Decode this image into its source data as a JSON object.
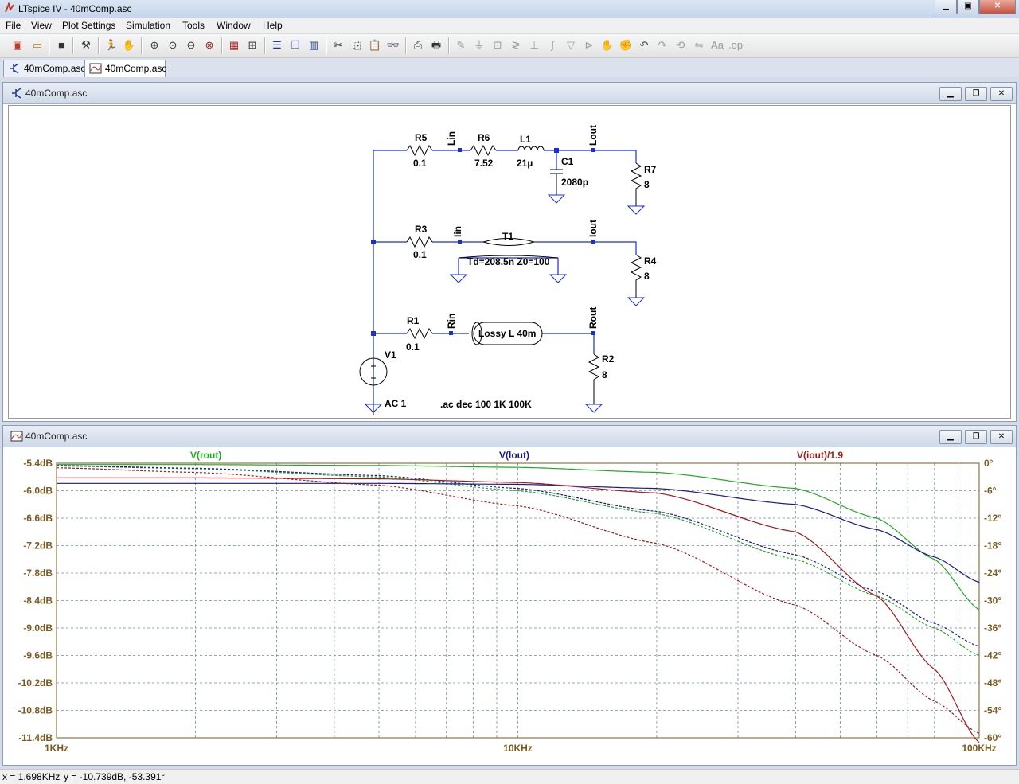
{
  "window": {
    "title": "LTspice IV - 40mComp.asc"
  },
  "menu": [
    "File",
    "View",
    "Plot Settings",
    "Simulation",
    "Tools",
    "Window",
    "Help"
  ],
  "toolbar_icons": [
    "new-schematic",
    "open",
    "save",
    "control-panel",
    "run",
    "halt",
    "zoom-in",
    "zoom-pan",
    "zoom-out",
    "zoom-cancel",
    "autorange",
    "zoom-fit",
    "tile-horizontal",
    "cascade",
    "tile-vertical",
    "cut",
    "copy",
    "paste",
    "find",
    "print-setup",
    "print",
    "wire",
    "ground",
    "label-net",
    "resistor",
    "capacitor",
    "inductor",
    "diode",
    "component",
    "move",
    "drag",
    "undo",
    "redo",
    "rotate",
    "mirror",
    "text",
    "spice-directive"
  ],
  "tabs": [
    {
      "label": "40mComp.asc",
      "icon": "schematic-icon"
    },
    {
      "label": "40mComp.asc",
      "icon": "waveform-icon"
    }
  ],
  "schematic": {
    "title": "40mComp.asc",
    "labels": {
      "R5": "R5",
      "R5v": "0.1",
      "R6": "R6",
      "R6v": "7.52",
      "L1": "L1",
      "L1v": "21µ",
      "C1": "C1",
      "C1v": "2080p",
      "R7": "R7",
      "R7v": "8",
      "R3": "R3",
      "R3v": "0.1",
      "T1": "T1",
      "T1v": "Td=208.5n Z0=100",
      "R4": "R4",
      "R4v": "8",
      "R1": "R1",
      "R1v": "0.1",
      "lossy": "Lossy L 40m",
      "R2": "R2",
      "R2v": "8",
      "V1": "V1",
      "V1v": "AC 1",
      "directive": ".ac dec 100 1K 100K",
      "Lin": "Lin",
      "Lout": "Lout",
      "Iin": "Iin",
      "Iout": "Iout",
      "Rin": "Rin",
      "Rout": "Rout"
    }
  },
  "plot": {
    "title": "40mComp.asc",
    "trace_labels": {
      "rout": "V(rout)",
      "lout": "V(lout)",
      "iout": "V(iout)/1.9"
    },
    "colors": {
      "rout": "#22a822",
      "lout": "#1a1a8c",
      "iout": "#9e1a1a",
      "grid": "#6f86b0",
      "axis": "#7a5a20"
    },
    "y_ticks_left": [
      "-5.4dB",
      "-6.0dB",
      "-6.6dB",
      "-7.2dB",
      "-7.8dB",
      "-8.4dB",
      "-9.0dB",
      "-9.6dB",
      "-10.2dB",
      "-10.8dB",
      "-11.4dB"
    ],
    "y_ticks_right": [
      "0°",
      "-6°",
      "-12°",
      "-18°",
      "-24°",
      "-30°",
      "-36°",
      "-42°",
      "-48°",
      "-54°",
      "-60°"
    ],
    "x_ticks": [
      "1KHz",
      "10KHz",
      "100KHz"
    ]
  },
  "chart_data": {
    "type": "line",
    "xlabel": "",
    "ylabel": "",
    "x_scale": "log",
    "xlim": [
      1000,
      100000
    ],
    "ylim": [
      -11.4,
      -5.4
    ],
    "ylim_phase": [
      -60,
      0
    ],
    "grid": true,
    "legend": "top",
    "series": [
      {
        "name": "V(rout)",
        "kind": "magnitude",
        "color": "#22a822",
        "x": [
          1000,
          2000,
          5000,
          10000,
          20000,
          40000,
          60000,
          80000,
          100000
        ],
        "y": [
          -5.43,
          -5.43,
          -5.45,
          -5.49,
          -5.6,
          -5.95,
          -6.6,
          -7.5,
          -8.6
        ]
      },
      {
        "name": "V(rout)",
        "kind": "phase",
        "color": "#22a822",
        "x": [
          1000,
          2000,
          5000,
          10000,
          20000,
          40000,
          60000,
          80000,
          100000
        ],
        "y": [
          -0.6,
          -1.2,
          -3,
          -6,
          -11,
          -21,
          -29,
          -36,
          -42
        ]
      },
      {
        "name": "V(lout)",
        "kind": "magnitude",
        "color": "#1a1a8c",
        "x": [
          1000,
          2000,
          5000,
          10000,
          20000,
          40000,
          60000,
          80000,
          100000
        ],
        "y": [
          -5.84,
          -5.84,
          -5.84,
          -5.86,
          -5.95,
          -6.3,
          -6.85,
          -7.45,
          -8.0
        ]
      },
      {
        "name": "V(lout)",
        "kind": "phase",
        "color": "#1a1a8c",
        "x": [
          1000,
          2000,
          5000,
          10000,
          20000,
          40000,
          60000,
          80000,
          100000
        ],
        "y": [
          -0.5,
          -1.1,
          -2.7,
          -5.5,
          -10.5,
          -20,
          -28,
          -35,
          -40
        ]
      },
      {
        "name": "V(iout)/1.9",
        "kind": "magnitude",
        "color": "#9e1a1a",
        "x": [
          1000,
          2000,
          5000,
          10000,
          20000,
          40000,
          60000,
          80000,
          100000
        ],
        "y": [
          -5.72,
          -5.72,
          -5.74,
          -5.82,
          -6.05,
          -6.9,
          -8.3,
          -9.9,
          -11.5
        ]
      },
      {
        "name": "V(iout)/1.9",
        "kind": "phase",
        "color": "#9e1a1a",
        "x": [
          1000,
          2000,
          5000,
          10000,
          20000,
          40000,
          60000,
          80000,
          100000
        ],
        "y": [
          -1,
          -2,
          -4.8,
          -9.3,
          -17.5,
          -31,
          -42,
          -52,
          -59
        ]
      }
    ]
  },
  "status": {
    "x": "x = 1.698KHz",
    "y": "y = -10.739dB, -53.391°"
  }
}
